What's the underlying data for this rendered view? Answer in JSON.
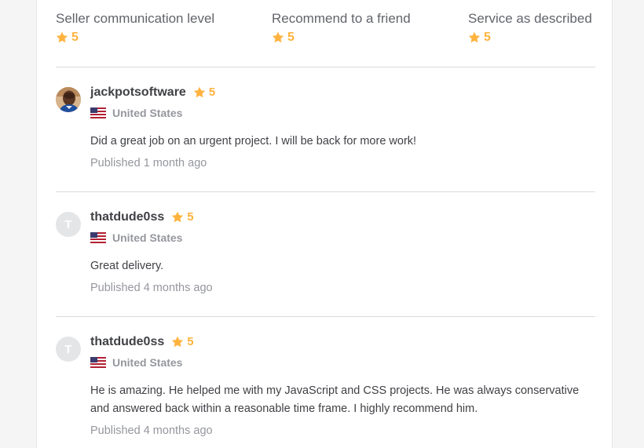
{
  "colors": {
    "star": "#ffb33e",
    "divider": "#dadbdd",
    "muted": "#95979d",
    "text": "#404145"
  },
  "breakdown": [
    {
      "label": "Seller communication level",
      "value": "5",
      "icon": "star-icon"
    },
    {
      "label": "Recommend to a friend",
      "value": "5",
      "icon": "star-icon"
    },
    {
      "label": "Service as described",
      "value": "5",
      "icon": "star-icon"
    }
  ],
  "reviews": [
    {
      "avatar": "profile-photo",
      "avatar_letter": "",
      "username": "jackpotsoftware",
      "rating": "5",
      "country": "United States",
      "flag_icon": "us-flag-icon",
      "text": "Did a great job on an urgent project. I will be back for more work!",
      "published": "Published 1 month ago"
    },
    {
      "avatar": "letter",
      "avatar_letter": "T",
      "username": "thatdude0ss",
      "rating": "5",
      "country": "United States",
      "flag_icon": "us-flag-icon",
      "text": "Great delivery.",
      "published": "Published 4 months ago"
    },
    {
      "avatar": "letter",
      "avatar_letter": "T",
      "username": "thatdude0ss",
      "rating": "5",
      "country": "United States",
      "flag_icon": "us-flag-icon",
      "text": "He is amazing. He helped me with my JavaScript and CSS projects. He was always conservative and answered back within a reasonable time frame. I highly recommend him.",
      "published": "Published 4 months ago"
    }
  ]
}
